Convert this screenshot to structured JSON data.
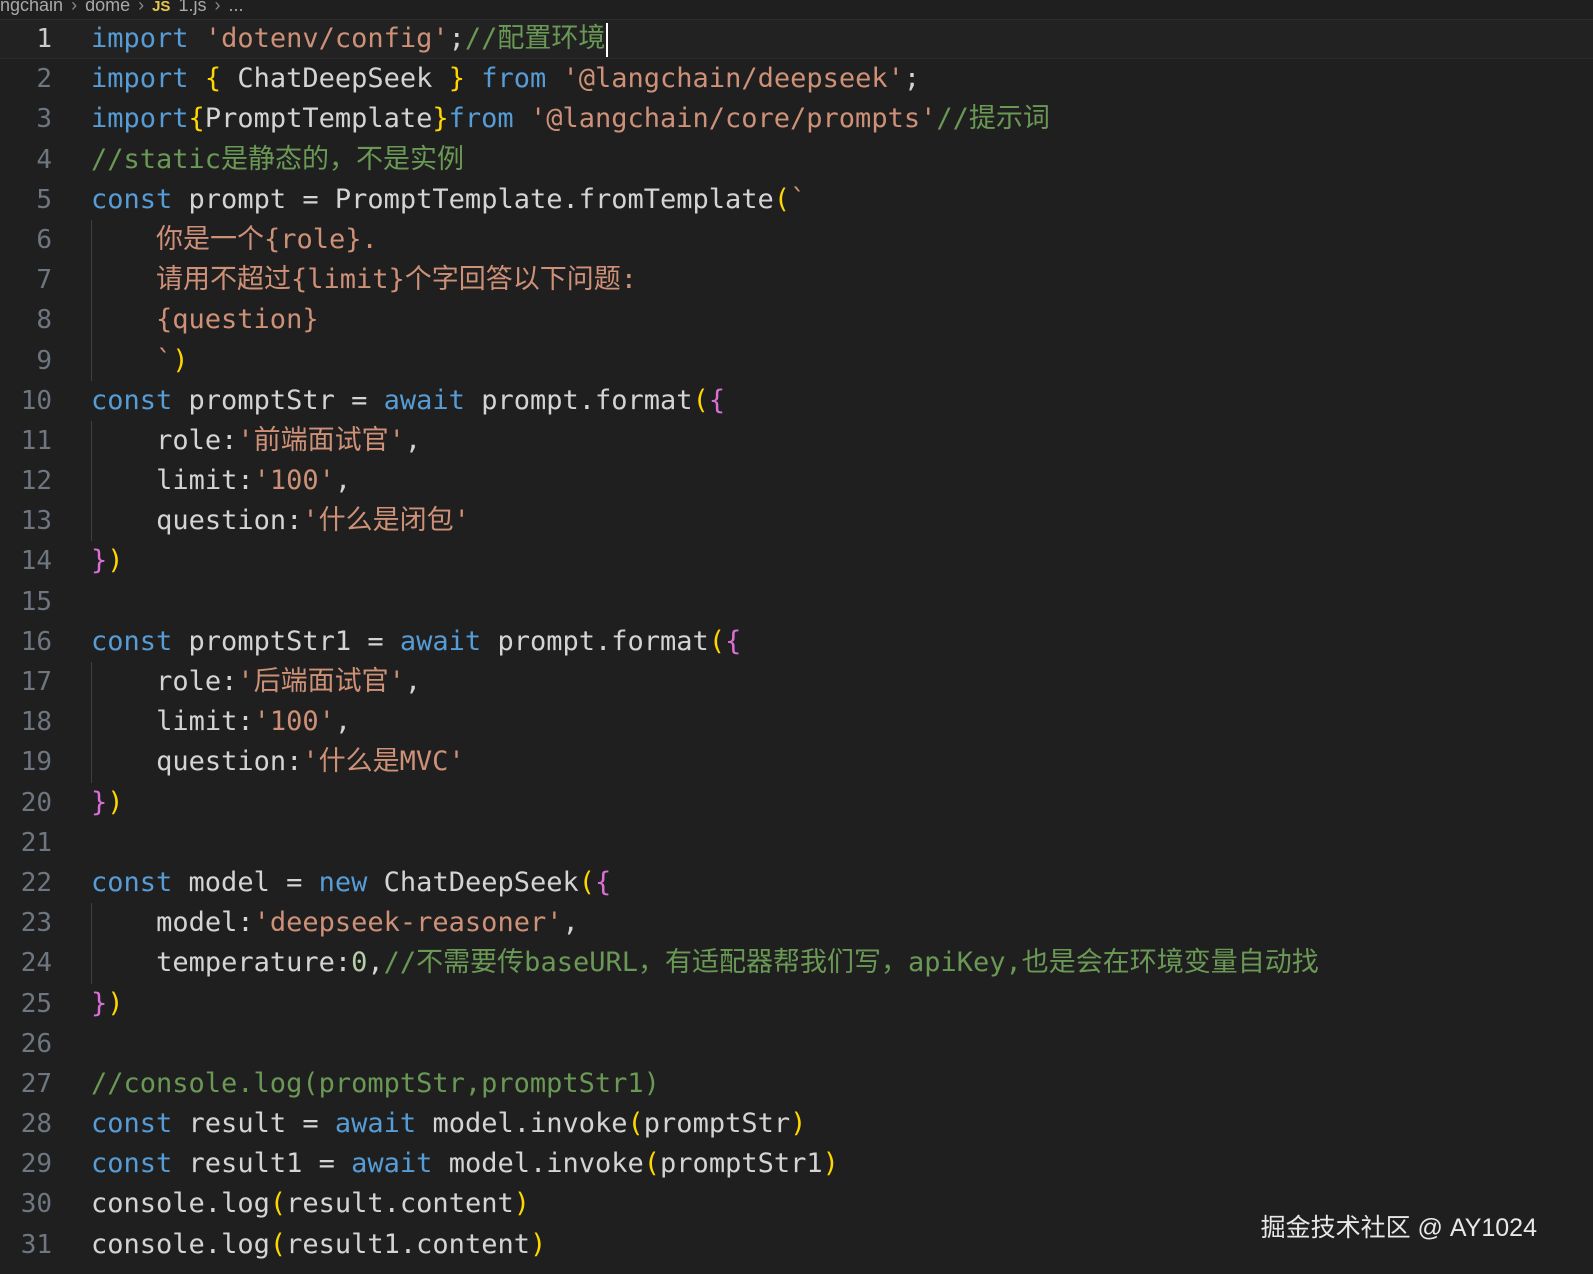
{
  "breadcrumb": {
    "segments": [
      "ngchain",
      "dome"
    ],
    "file_icon": "JS",
    "file_name": "1.js",
    "ellipsis": "..."
  },
  "editor": {
    "active_line": 1,
    "line_numbers": [
      "1",
      "2",
      "3",
      "4",
      "5",
      "6",
      "7",
      "8",
      "9",
      "10",
      "11",
      "12",
      "13",
      "14",
      "15",
      "16",
      "17",
      "18",
      "19",
      "20",
      "21",
      "22",
      "23",
      "24",
      "25",
      "26",
      "27",
      "28",
      "29",
      "30",
      "31"
    ],
    "code_lines": [
      "import 'dotenv/config';//配置环境",
      "import { ChatDeepSeek } from '@langchain/deepseek';",
      "import{PromptTemplate}from '@langchain/core/prompts'//提示词",
      "//static是静态的，不是实例",
      "const prompt = PromptTemplate.fromTemplate(`",
      "    你是一个{role}.",
      "    请用不超过{limit}个字回答以下问题:",
      "    {question}",
      "    `)",
      "const promptStr = await prompt.format({",
      "    role:'前端面试官',",
      "    limit:'100',",
      "    question:'什么是闭包'",
      "})",
      "",
      "const promptStr1 = await prompt.format({",
      "    role:'后端面试官',",
      "    limit:'100',",
      "    question:'什么是MVC'",
      "})",
      "",
      "const model = new ChatDeepSeek({",
      "    model:'deepseek-reasoner',",
      "    temperature:0,//不需要传baseURL，有适配器帮我们写，apiKey,也是会在环境变量自动找",
      "})",
      "",
      "//console.log(promptStr,promptStr1)",
      "const result = await model.invoke(promptStr)",
      "const result1 = await model.invoke(promptStr1)",
      "console.log(result.content)",
      "console.log(result1.content)"
    ]
  },
  "watermark": "掘金技术社区 @ AY1024",
  "colors": {
    "background": "#1f1f1f",
    "keyword": "#569cd6",
    "string": "#ce9178",
    "comment": "#6a9955",
    "identifier": "#d4d4d4",
    "bracket_level1": "#ffd700",
    "bracket_level2": "#da70d6"
  }
}
